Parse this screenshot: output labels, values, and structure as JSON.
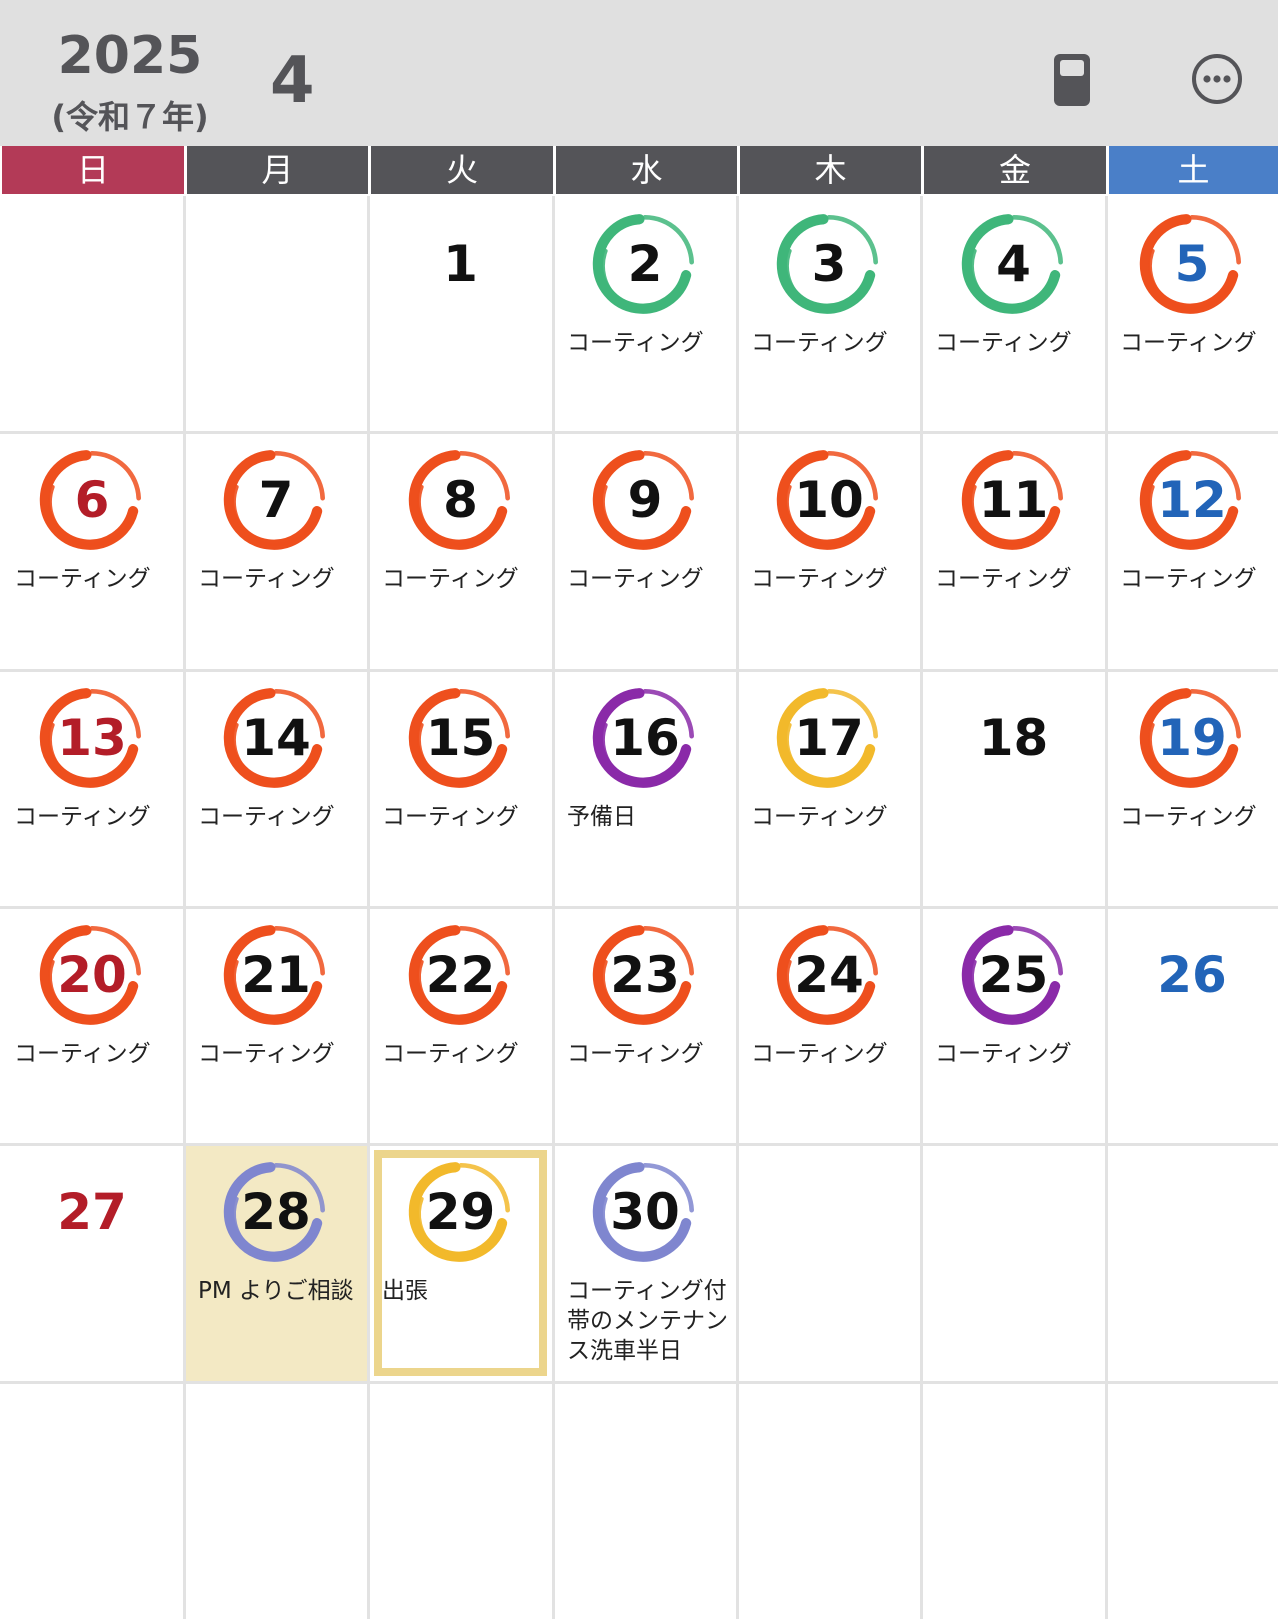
{
  "header": {
    "year": "2025",
    "era": "(令和７年)",
    "month": "4",
    "icons": {
      "calculator": "calculator-icon",
      "more": "more-options-icon"
    },
    "icon_color": "#545458"
  },
  "weekdays": [
    {
      "label": "日",
      "color": "#b33a57"
    },
    {
      "label": "月",
      "color": "#545458"
    },
    {
      "label": "火",
      "color": "#545458"
    },
    {
      "label": "水",
      "color": "#545458"
    },
    {
      "label": "木",
      "color": "#545458"
    },
    {
      "label": "金",
      "color": "#545458"
    },
    {
      "label": "土",
      "color": "#4a7fc8"
    }
  ],
  "ring_colors": {
    "green": "#3fb67a",
    "orange": "#ee4f1d",
    "purple": "#8a2aa8",
    "yellow": "#f2b92b",
    "periwinkle": "#7f86cf"
  },
  "days": [
    {
      "day": "1",
      "ring": null,
      "event": ""
    },
    {
      "day": "2",
      "ring": "green",
      "event": "コーティング"
    },
    {
      "day": "3",
      "ring": "green",
      "event": "コーティング"
    },
    {
      "day": "4",
      "ring": "green",
      "event": "コーティング"
    },
    {
      "day": "5",
      "ring": "orange",
      "event": "コーティング"
    },
    {
      "day": "6",
      "ring": "orange",
      "event": "コーティング"
    },
    {
      "day": "7",
      "ring": "orange",
      "event": "コーティング"
    },
    {
      "day": "8",
      "ring": "orange",
      "event": "コーティング"
    },
    {
      "day": "9",
      "ring": "orange",
      "event": "コーティング"
    },
    {
      "day": "10",
      "ring": "orange",
      "event": "コーティング"
    },
    {
      "day": "11",
      "ring": "orange",
      "event": "コーティング"
    },
    {
      "day": "12",
      "ring": "orange",
      "event": "コーティング"
    },
    {
      "day": "13",
      "ring": "orange",
      "event": "コーティング"
    },
    {
      "day": "14",
      "ring": "orange",
      "event": "コーティング"
    },
    {
      "day": "15",
      "ring": "orange",
      "event": "コーティング"
    },
    {
      "day": "16",
      "ring": "purple",
      "event": "予備日"
    },
    {
      "day": "17",
      "ring": "yellow",
      "event": "コーティング"
    },
    {
      "day": "18",
      "ring": null,
      "event": ""
    },
    {
      "day": "19",
      "ring": "orange",
      "event": "コーティング"
    },
    {
      "day": "20",
      "ring": "orange",
      "event": "コーティング"
    },
    {
      "day": "21",
      "ring": "orange",
      "event": "コーティング"
    },
    {
      "day": "22",
      "ring": "orange",
      "event": "コーティング"
    },
    {
      "day": "23",
      "ring": "orange",
      "event": "コーティング"
    },
    {
      "day": "24",
      "ring": "orange",
      "event": "コーティング"
    },
    {
      "day": "25",
      "ring": "purple",
      "event": "コーティング"
    },
    {
      "day": "26",
      "ring": null,
      "event": ""
    },
    {
      "day": "27",
      "ring": null,
      "event": ""
    },
    {
      "day": "28",
      "ring": "periwinkle",
      "event": "PM よりご相談",
      "highlight": true
    },
    {
      "day": "29",
      "ring": "yellow",
      "event": "出張",
      "today": true
    },
    {
      "day": "30",
      "ring": "periwinkle",
      "event": "コーティング付帯のメンテナンス洗車半日"
    }
  ]
}
